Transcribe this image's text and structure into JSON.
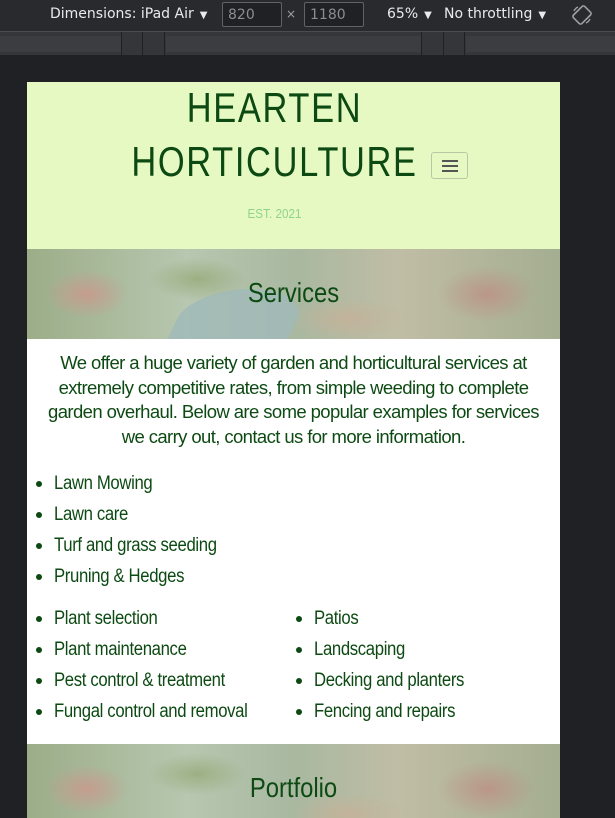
{
  "devtools": {
    "dimensions_label": "Dimensions: iPad Air",
    "width_value": "820",
    "height_value": "1180",
    "times": "×",
    "zoom_label": "65%",
    "throttle_label": "No throttling",
    "icons": {
      "dropdown": "caret-down-icon",
      "rotate": "rotate-icon"
    }
  },
  "site": {
    "brand_line1": "HEARTEN",
    "brand_line2": "HORTICULTURE",
    "est": "EST. 2021",
    "colors": {
      "header_bg": "#e6f9c2",
      "brand_green": "#0d4a13",
      "est_green": "#8fd48a"
    }
  },
  "services": {
    "title": "Services",
    "intro": "We offer a huge variety of garden and horticultural services at extremely competitive rates, from simple weeding to complete garden overhaul. Below are some popular examples for services we carry out, contact us for more information.",
    "list_a": [
      "Lawn Mowing",
      "Lawn care",
      "Turf and grass seeding",
      "Pruning & Hedges"
    ],
    "list_b": [
      "Plant selection",
      "Plant maintenance",
      "Pest control & treatment",
      "Fungal control and removal"
    ],
    "list_c": [
      "Patios",
      "Landscaping",
      "Decking and planters",
      "Fencing and repairs"
    ]
  },
  "portfolio": {
    "title": "Portfolio"
  }
}
